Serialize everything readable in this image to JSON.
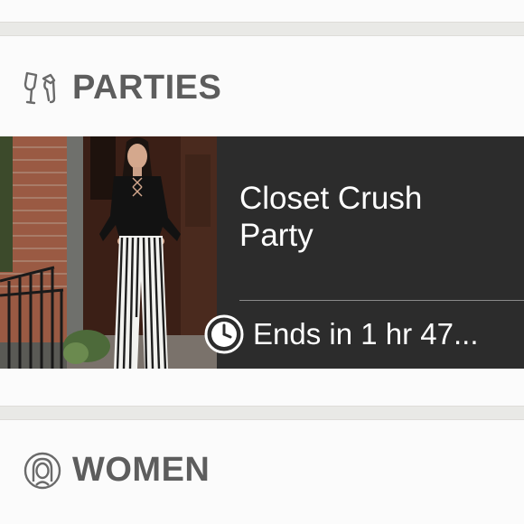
{
  "sections": {
    "parties": {
      "title": "PARTIES",
      "icon": "champagne-glasses-icon"
    },
    "women": {
      "title": "WOMEN",
      "icon": "woman-avatar-icon"
    }
  },
  "party_card": {
    "name": "Closet Crush\nParty",
    "ends_text": "Ends in 1 hr 47...",
    "clock_icon": "clock-icon"
  },
  "colors": {
    "page_background": "#fbfbfb",
    "divider": "#e9e9e6",
    "section_title": "#5d5d5d",
    "card_background": "#2c2c2c",
    "card_text": "#ffffff"
  }
}
